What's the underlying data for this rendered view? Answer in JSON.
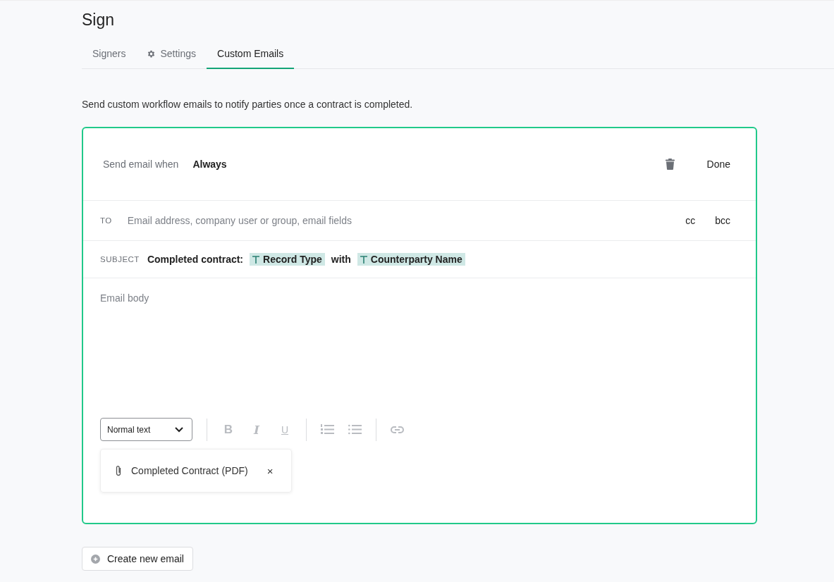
{
  "page": {
    "title": "Sign"
  },
  "tabs": [
    {
      "label": "Signers",
      "kind": "plain",
      "selected": false
    },
    {
      "label": "Settings",
      "kind": "settings",
      "selected": false
    },
    {
      "label": "Custom Emails",
      "kind": "plain",
      "selected": true
    }
  ],
  "description": "Send custom workflow emails to notify parties once a contract is completed.",
  "email": {
    "active": true,
    "condition": {
      "label": "Send email when",
      "value": "Always"
    },
    "done": "Done",
    "to": {
      "label": "TO",
      "placeholder": "Email address, company user or group, email fields",
      "cc": "cc",
      "bcc": "bcc"
    },
    "subject": {
      "label": "SUBJECT",
      "parts": [
        {
          "kind": "text",
          "text": "Completed contract:"
        },
        {
          "kind": "field",
          "text": "Record Type"
        },
        {
          "kind": "text",
          "text": "with"
        },
        {
          "kind": "field",
          "text": "Counterparty Name"
        }
      ]
    },
    "body": {
      "placeholder": "Email body"
    },
    "toolbar": {
      "style": "Normal text",
      "groups": [
        [
          {
            "kind": "bold",
            "label": "B"
          },
          {
            "kind": "italic",
            "label": "I"
          },
          {
            "kind": "underline",
            "label": "U"
          }
        ],
        [
          {
            "kind": "numbered-list"
          },
          {
            "kind": "bullet-list"
          }
        ],
        [
          {
            "kind": "link"
          }
        ]
      ]
    },
    "attachments": [
      {
        "name": "Completed Contract (PDF)",
        "remove": "×"
      }
    ]
  },
  "create_button": "Create new email"
}
